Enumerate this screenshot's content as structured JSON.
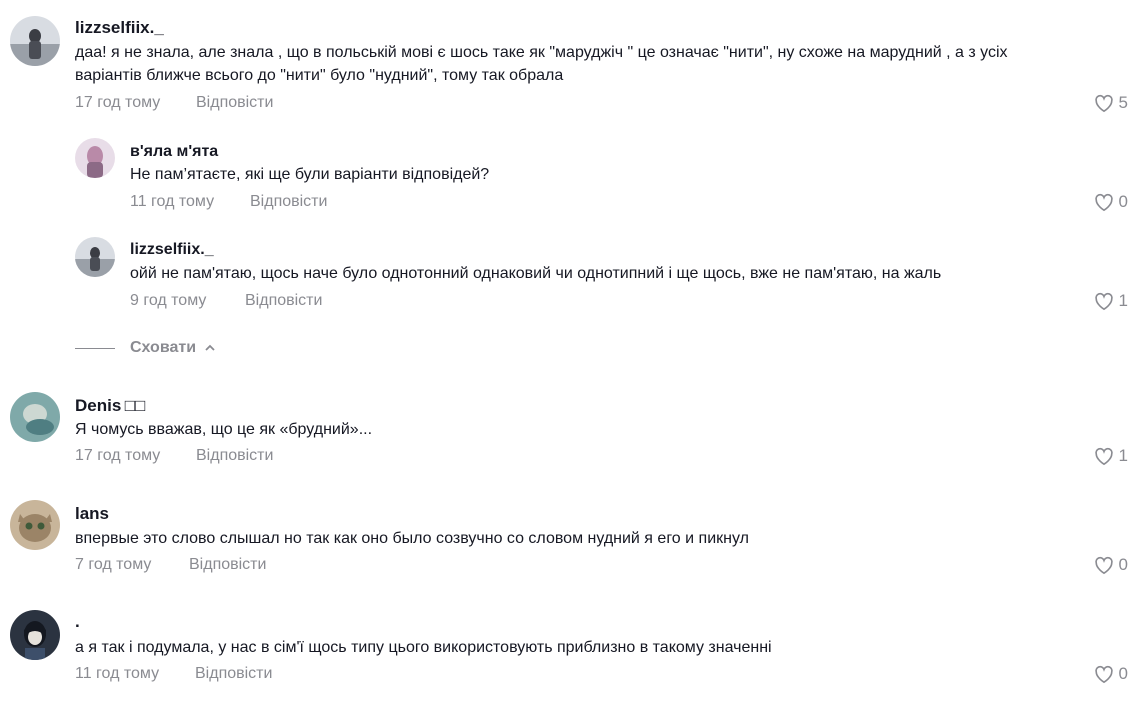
{
  "reply_label": "Відповісти",
  "collapse_label": "Сховати",
  "comments": [
    {
      "username": "lizzselfiix._",
      "text_lines": [
        "даа! я не знала, але знала , що в польській мові є шось таке як \"маруджіч \" це означає \"нити\", ну схоже на марудний , а з усіх",
        "варіантів ближче всього до \"нити\" було \"нудний\", тому так обрала"
      ],
      "time": "17 год тому",
      "likes": "5"
    },
    {
      "username": "в'яла м'ята",
      "text_lines": [
        "Не пам’ятаєте, які ще були варіанти відповідей?"
      ],
      "time": "11 год тому",
      "likes": "0"
    },
    {
      "username": "lizzselfiix._",
      "text_lines": [
        "ойй не пам'ятаю, щось наче було однотонний однаковий чи однотипний і ще щось, вже не пам'ятаю, на жаль"
      ],
      "time": "9 год тому",
      "likes": "1"
    },
    {
      "username": "Denis □□",
      "text_lines": [
        "Я чомусь вважав, що це як «брудний»..."
      ],
      "time": "17 год тому",
      "likes": "1"
    },
    {
      "username": "lans",
      "text_lines": [
        "впервые это слово слышал но так как оно было созвучно со словом нудний я его и пикнул"
      ],
      "time": "7 год тому",
      "likes": "0"
    },
    {
      "username": ".",
      "text_lines": [
        "а я так і подумала, у нас в сім'ї щось типу цього використовують приблизно в такому значенні"
      ],
      "time": "11 год тому",
      "likes": "0"
    }
  ],
  "colors": {
    "text": "#161823",
    "muted": "#8a8b91",
    "background": "#ffffff"
  }
}
